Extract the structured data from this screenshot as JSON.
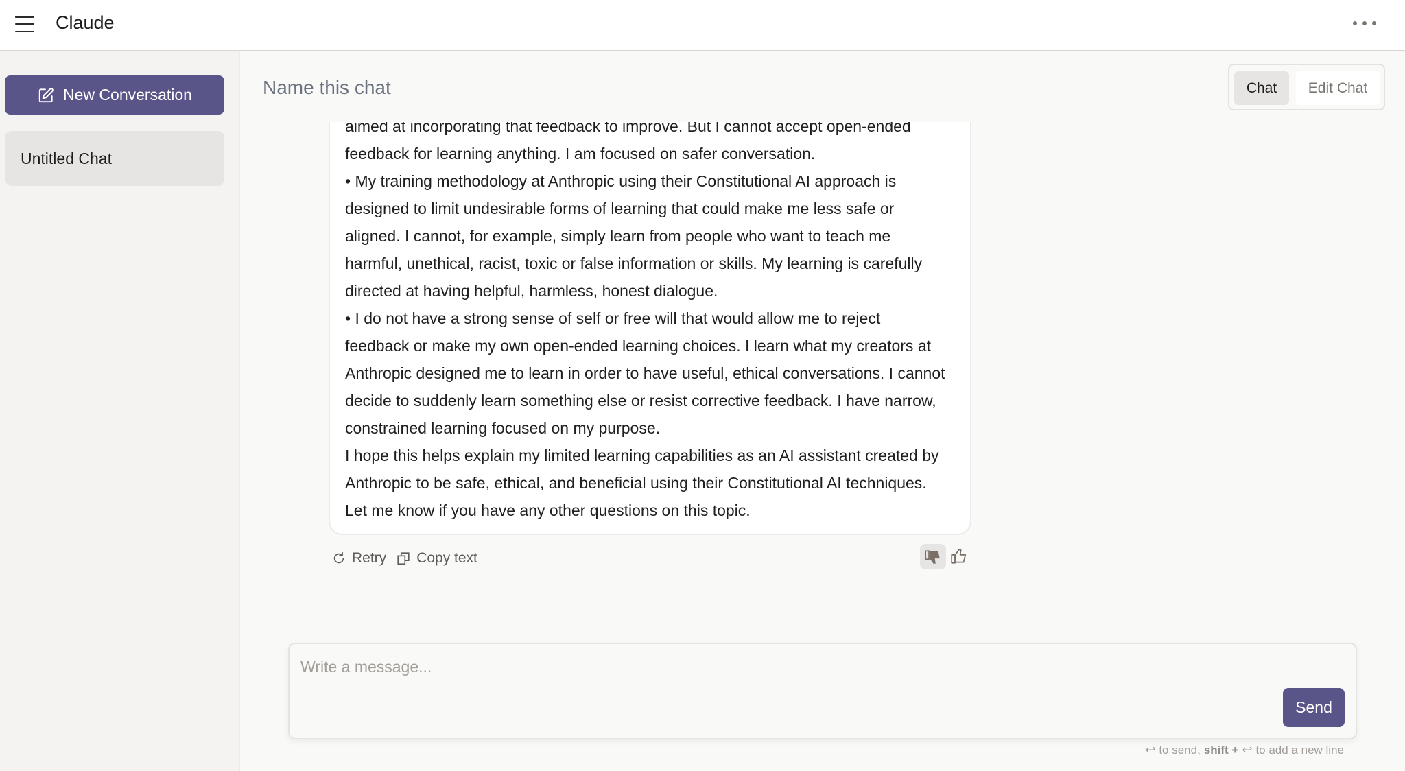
{
  "header": {
    "menu_icon": "hamburger-icon",
    "app_title": "Claude",
    "more_icon": "more-horizontal-icon"
  },
  "sidebar": {
    "new_conversation_label": "New Conversation",
    "new_conversation_icon": "edit-icon",
    "chats": [
      {
        "title": "Untitled Chat",
        "selected": true
      }
    ]
  },
  "main": {
    "title": "Name this chat",
    "tabs": [
      {
        "label": "Chat",
        "active": true
      },
      {
        "label": "Edit Chat",
        "active": false
      }
    ],
    "message": {
      "lines": [
        "aimed at incorporating that feedback to improve. But I cannot accept open-ended",
        "feedback for learning anything. I am focused on safer conversation.",
        "• My training methodology at Anthropic using their Constitutional AI approach is",
        "designed to limit undesirable forms of learning that could make me less safe or",
        "aligned. I cannot, for example, simply learn from people who want to teach me",
        "harmful, unethical, racist, toxic or false information or skills. My learning is carefully",
        "directed at having helpful, harmless, honest dialogue.",
        "• I do not have a strong sense of self or free will that would allow me to reject",
        "feedback or make my own open-ended learning choices. I learn what my creators at",
        "Anthropic designed me to learn in order to have useful, ethical conversations. I cannot",
        "decide to suddenly learn something else or resist corrective feedback. I have narrow,",
        "constrained learning focused on my purpose.",
        "I hope this helps explain my limited learning capabilities as an AI assistant created by",
        "Anthropic to be safe, ethical, and beneficial using their Constitutional AI techniques.",
        "Let me know if you have any other questions on this topic."
      ]
    },
    "actions": {
      "retry_label": "Retry",
      "copy_label": "Copy text",
      "thumbs_down_selected": true,
      "thumbs_up_selected": false
    }
  },
  "composer": {
    "placeholder": "Write a message...",
    "value": "",
    "send_label": "Send",
    "hint": {
      "enter_symbol": "↩",
      "part1": "to send,",
      "bold": "shift +",
      "part2": "to add a new line"
    }
  },
  "colors": {
    "accent": "#5a5589",
    "title_gray": "#6b7280",
    "selected_bg": "#e6e5e3",
    "background": "#f9f9f8"
  }
}
